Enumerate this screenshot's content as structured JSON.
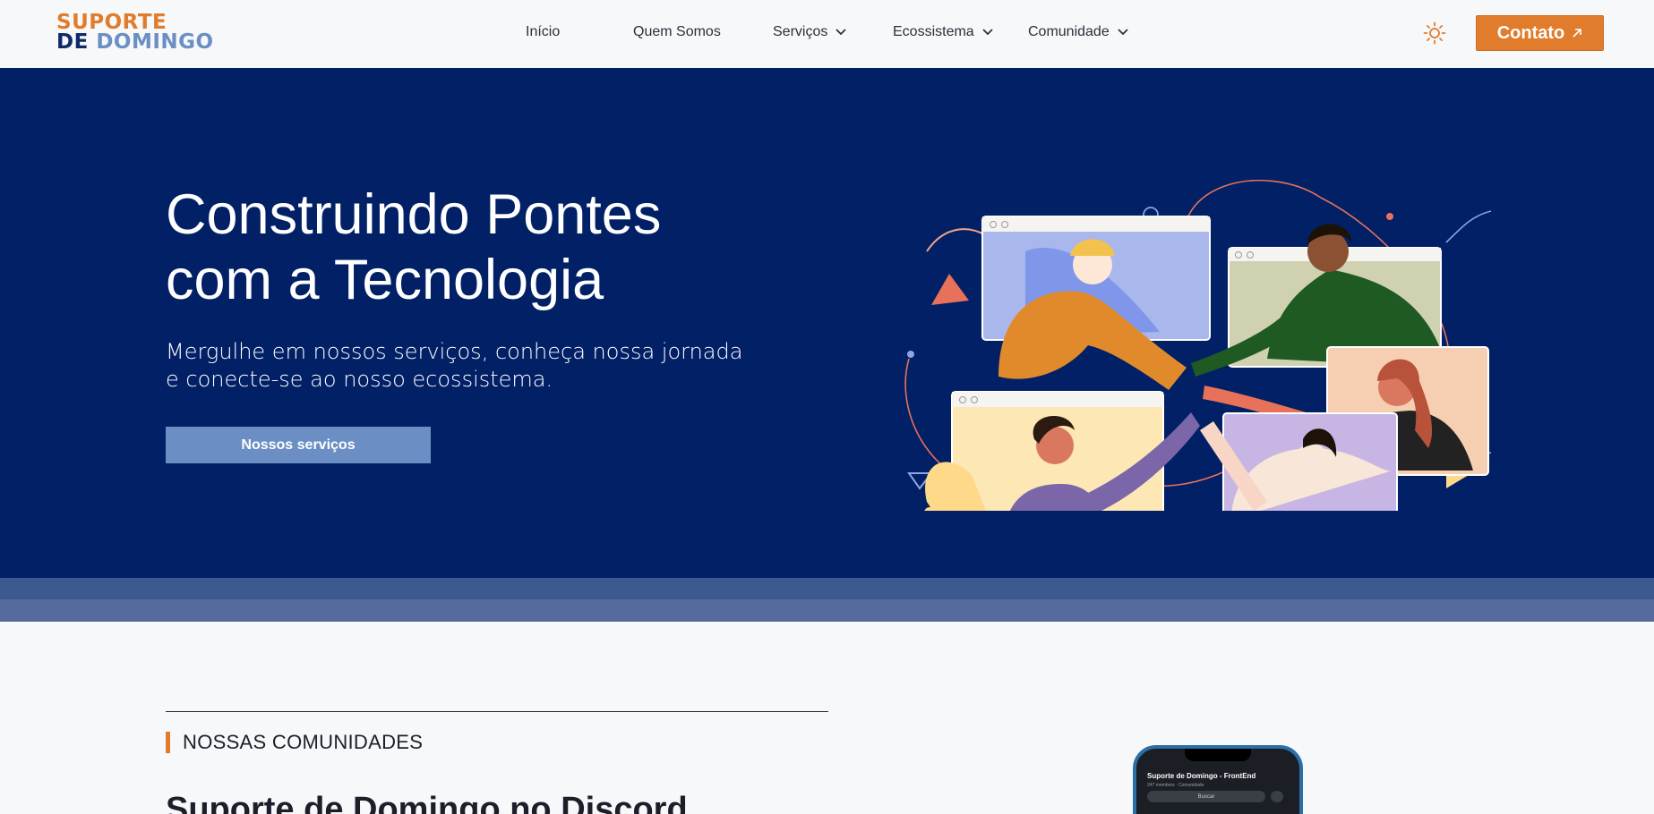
{
  "header": {
    "logo_line1": "SUPORTE",
    "logo_line2a": "DE",
    "logo_line2b": "DOMINGO",
    "nav": {
      "inicio": "Início",
      "quem_somos": "Quem Somos",
      "servicos": "Serviços",
      "ecossistema": "Ecossistema",
      "comunidade": "Comunidade"
    },
    "theme_icon": "sun-icon",
    "contact_label": "Contato"
  },
  "hero": {
    "title_line1": "Construindo Pontes",
    "title_line2": "com a Tecnologia",
    "subtitle_line1": "Mergulhe em nossos serviços, conheça nossa jornada",
    "subtitle_line2": "e conecte-se ao nosso ecossistema.",
    "cta_label": "Nossos serviços"
  },
  "communities": {
    "tag": "NOSSAS COMUNIDADES",
    "title": "Suporte de Domingo no Discord",
    "phone_title": "Suporte de Domingo - FrontEnd",
    "phone_sub": "247 membros  ·  Comunidade",
    "phone_search": "Buscar"
  },
  "colors": {
    "brand_orange": "#e07c2c",
    "brand_navy": "#012066",
    "brand_blue": "#6b8fc4"
  }
}
